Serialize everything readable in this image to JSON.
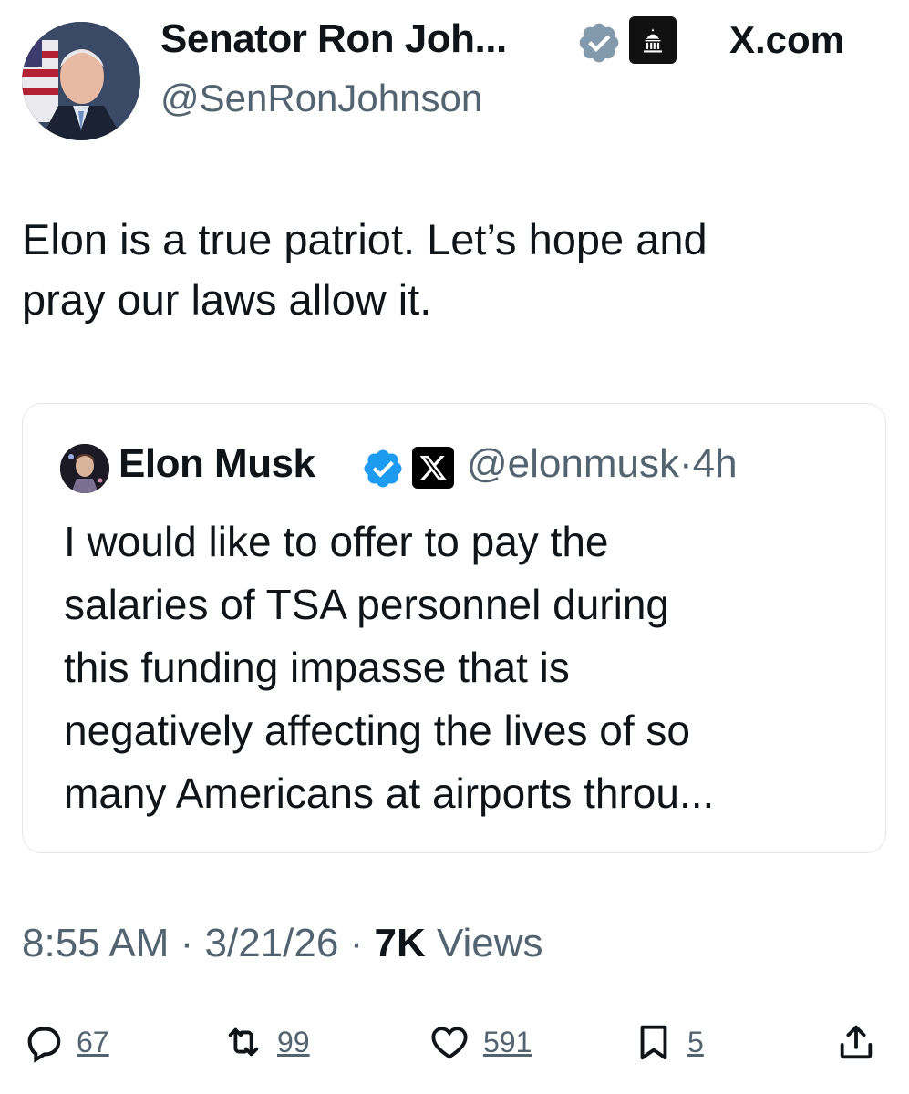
{
  "tweet": {
    "display_name": "Senator Ron Joh...",
    "handle": "@SenRonJohnson",
    "site_label": "X.com",
    "text_lines": [
      "Elon is a true patriot. Let’s hope and",
      "pray our laws allow it."
    ]
  },
  "quote": {
    "name": "Elon Musk",
    "handle": "@elonmusk",
    "separator": "·",
    "time": "4h",
    "text_lines": [
      "I would like to offer to pay the",
      "salaries of TSA personnel during",
      "this funding impasse that is",
      "negatively affecting the lives of so",
      "many Americans at airports throu..."
    ]
  },
  "meta": {
    "time": "8:55 AM",
    "sep1": " · ",
    "date": "3/21/26",
    "sep2": " · ",
    "views_count": "7K",
    "views_label": " Views"
  },
  "actions": {
    "replies": "67",
    "reposts": "99",
    "likes": "591",
    "bookmarks": "5"
  },
  "icons": {
    "verified_gray": "verified-gray-icon",
    "government_badge": "capitol-icon",
    "verified_blue": "verified-blue-icon",
    "x_logo": "x-logo-icon",
    "reply": "reply-icon",
    "repost": "repost-icon",
    "like": "heart-icon",
    "bookmark": "bookmark-icon",
    "share": "share-icon"
  },
  "colors": {
    "text": "#0f1419",
    "secondary": "#536471",
    "verified_blue": "#1d9bf0",
    "verified_gray": "#829aab"
  }
}
